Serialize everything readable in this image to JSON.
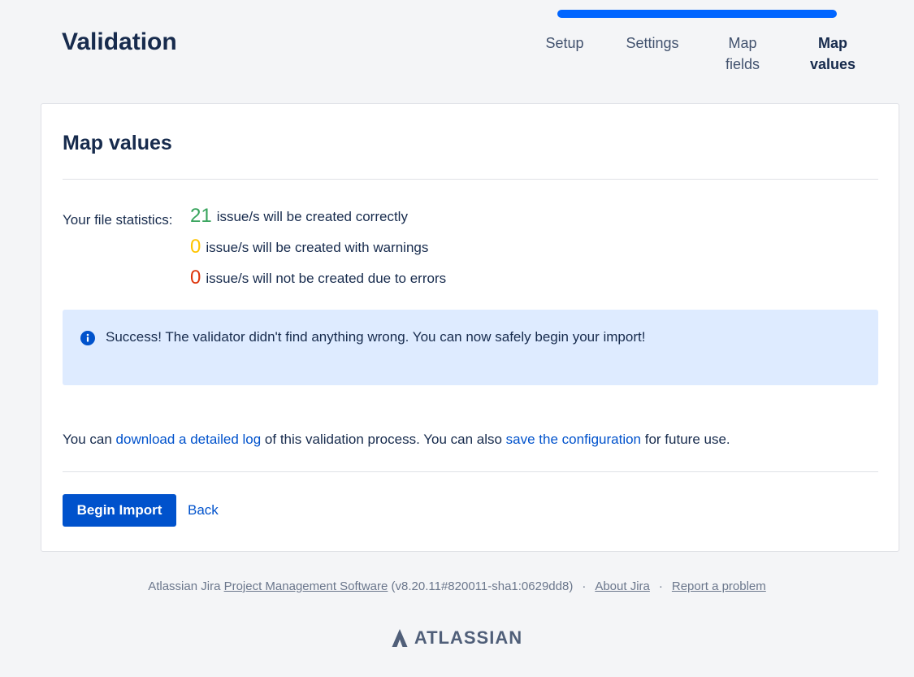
{
  "header": {
    "title": "Validation",
    "progress_percent": 100,
    "steps": [
      {
        "label_line1": "Setup",
        "label_line2": "",
        "current": false
      },
      {
        "label_line1": "Settings",
        "label_line2": "",
        "current": false
      },
      {
        "label_line1": "Map",
        "label_line2": "fields",
        "current": false
      },
      {
        "label_line1": "Map",
        "label_line2": "values",
        "current": true
      }
    ]
  },
  "card": {
    "title": "Map values",
    "stats": {
      "label": "Your file statistics:",
      "created_count": "21",
      "created_text": "issue/s will be created correctly",
      "warnings_count": "0",
      "warnings_text": "issue/s will be created with warnings",
      "errors_count": "0",
      "errors_text": "issue/s will not be created due to errors"
    },
    "message": {
      "icon": "info-icon",
      "text": "Success! The validator didn't find anything wrong. You can now safely begin your import!"
    },
    "log": {
      "prefix": "You can ",
      "log_link": "download a detailed log",
      "middle": " of this validation process. You can also ",
      "config_link": "save the configuration",
      "suffix": " for future use."
    },
    "actions": {
      "primary_label": "Begin Import",
      "back_label": "Back"
    }
  },
  "footer": {
    "prefix": "Atlassian Jira ",
    "product_link": "Project Management Software",
    "version": " (v8.20.11#820011-sha1:0629dd8)",
    "separator": "·",
    "about_link": "About Jira",
    "report_link": "Report a problem",
    "brand": "ATLASSIAN"
  },
  "colors": {
    "accent": "#0052cc",
    "progress": "#0065ff",
    "success": "#36a35b",
    "warning": "#ffc400",
    "error": "#de350b",
    "info_bg": "#deebff"
  }
}
